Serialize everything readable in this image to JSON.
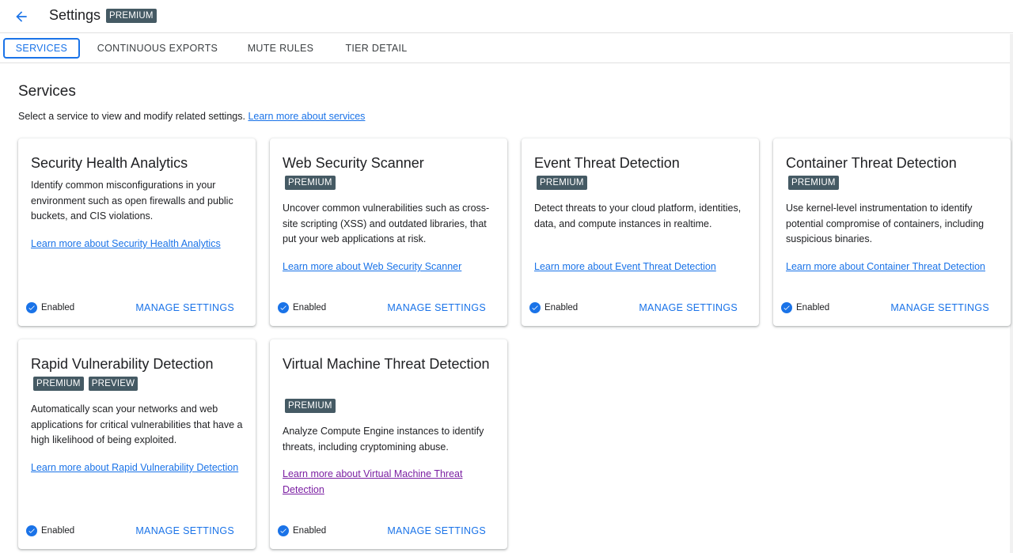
{
  "header": {
    "title": "Settings",
    "badge": "PREMIUM"
  },
  "tabs": [
    {
      "label": "SERVICES",
      "active": true
    },
    {
      "label": "CONTINUOUS EXPORTS",
      "active": false
    },
    {
      "label": "MUTE RULES",
      "active": false
    },
    {
      "label": "TIER DETAIL",
      "active": false
    }
  ],
  "section": {
    "title": "Services",
    "description": "Select a service to view and modify related settings.",
    "link": "Learn more about services"
  },
  "colors": {
    "accent": "#1a73e8",
    "badge_bg": "#455a64",
    "visited_link": "#7b1fa2"
  },
  "cards": [
    {
      "title": "Security Health Analytics",
      "badges": [],
      "description": "Identify common misconfigurations in your environment such as open firewalls and public buckets, and CIS violations.",
      "link": "Learn more about Security Health Analytics",
      "status": "Enabled",
      "action": "MANAGE SETTINGS"
    },
    {
      "title": "Web Security Scanner",
      "badges": [
        "PREMIUM"
      ],
      "description": "Uncover common vulnerabilities such as cross-site scripting (XSS) and outdated libraries, that put your web applications at risk.",
      "link": "Learn more about Web Security Scanner",
      "status": "Enabled",
      "action": "MANAGE SETTINGS"
    },
    {
      "title": "Event Threat Detection",
      "badges": [
        "PREMIUM"
      ],
      "description": "Detect threats to your cloud platform, identities, data, and compute instances in realtime.",
      "link": "Learn more about Event Threat Detection",
      "status": "Enabled",
      "action": "MANAGE SETTINGS"
    },
    {
      "title": "Container Threat Detection",
      "badges": [
        "PREMIUM"
      ],
      "description": "Use kernel-level instrumentation to identify potential compromise of containers, including suspicious binaries.",
      "link": "Learn more about Container Threat Detection",
      "status": "Enabled",
      "action": "MANAGE SETTINGS"
    },
    {
      "title": "Rapid Vulnerability Detection",
      "badges": [
        "PREMIUM",
        "PREVIEW"
      ],
      "description": "Automatically scan your networks and web applications for critical vulnerabilities that have a high likelihood of being exploited.",
      "link": "Learn more about Rapid Vulnerability Detection",
      "status": "Enabled",
      "action": "MANAGE SETTINGS"
    },
    {
      "title": "Virtual Machine Threat Detection",
      "badges": [
        "PREMIUM"
      ],
      "description": "Analyze Compute Engine instances to identify threats, including cryptomining abuse.",
      "link": "Learn more about Virtual Machine Threat Detection",
      "status": "Enabled",
      "action": "MANAGE SETTINGS"
    }
  ]
}
